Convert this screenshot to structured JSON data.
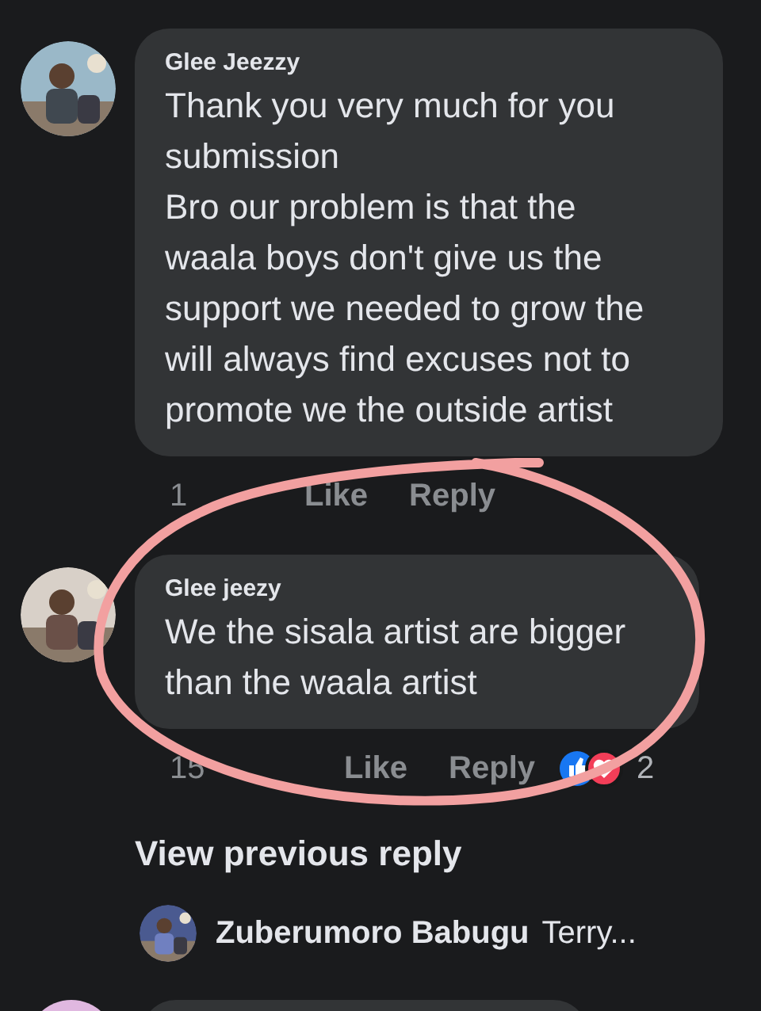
{
  "comments": [
    {
      "author": "Glee Jeezzy",
      "text": "Thank you very much for you submission\nBro our problem is that the waala boys don't give us the support we needed to grow the will always find excuses not to promote we the outside artist",
      "time": "1",
      "like": "Like",
      "reply": "Reply"
    },
    {
      "author": "Glee jeezy",
      "text": "We the sisala artist are bigger than the waala artist",
      "time": "15",
      "like": "Like",
      "reply": "Reply",
      "reaction_count": "2"
    }
  ],
  "view_previous": "View previous reply",
  "reply_preview": {
    "author": "Zuberumoro Babugu",
    "text": "Terry..."
  }
}
